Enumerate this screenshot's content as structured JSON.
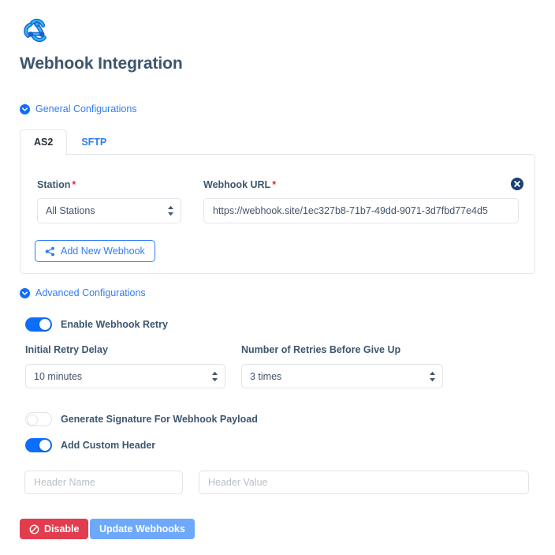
{
  "brand": {
    "logo_icon": "webhook-logo-icon",
    "logo_color_primary": "#1a5fd0",
    "logo_color_secondary": "#2bb8f0"
  },
  "header": {
    "title": "Webhook Integration",
    "title_color": "#3d566e"
  },
  "sections": {
    "general": {
      "label": "General Configurations",
      "caret_icon": "chevron-down-circle-icon",
      "expanded": true
    },
    "advanced": {
      "label": "Advanced Configurations",
      "caret_icon": "chevron-down-circle-icon",
      "expanded": true
    }
  },
  "tabs": [
    {
      "label": "AS2",
      "active": true
    },
    {
      "label": "SFTP",
      "active": false
    }
  ],
  "general_panel": {
    "station": {
      "label": "Station",
      "required": true,
      "required_marker": "*",
      "selected": "All Stations",
      "options": [
        "All Stations"
      ]
    },
    "webhook_url": {
      "label": "Webhook URL",
      "required": true,
      "required_marker": "*",
      "value": "https://webhook.site/1ec327b8-71b7-49dd-9071-3d7fbd77e4d5",
      "placeholder": "Webhook URL"
    },
    "remove_row_icon": "circle-x-remove-icon",
    "add_webhook": {
      "label": "Add New Webhook",
      "icon": "share-nodes-icon"
    }
  },
  "advanced_panel": {
    "enable_retry": {
      "label": "Enable Webhook Retry",
      "on": true
    },
    "initial_retry_delay": {
      "label": "Initial Retry Delay",
      "selected": "10 minutes",
      "options": [
        "10 minutes"
      ]
    },
    "retries_before_give_up": {
      "label": "Number of Retries Before Give Up",
      "selected": "3 times",
      "options": [
        "3 times"
      ]
    },
    "generate_signature": {
      "label": "Generate Signature For Webhook Payload",
      "on": false
    },
    "add_custom_header": {
      "label": "Add Custom Header",
      "on": true
    },
    "header_name": {
      "value": "",
      "placeholder": "Header Name"
    },
    "header_value": {
      "value": "",
      "placeholder": "Header Value"
    }
  },
  "footer": {
    "disable": {
      "label": "Disable",
      "icon": "ban-icon",
      "color": "#e23d4f"
    },
    "update": {
      "label": "Update Webhooks",
      "color": "#6ea8fa"
    }
  },
  "theme": {
    "link_blue": "#2f7cf6",
    "toggle_on": "#0d6efd",
    "required_red": "#e8243c",
    "border": "#e3e6ea"
  }
}
